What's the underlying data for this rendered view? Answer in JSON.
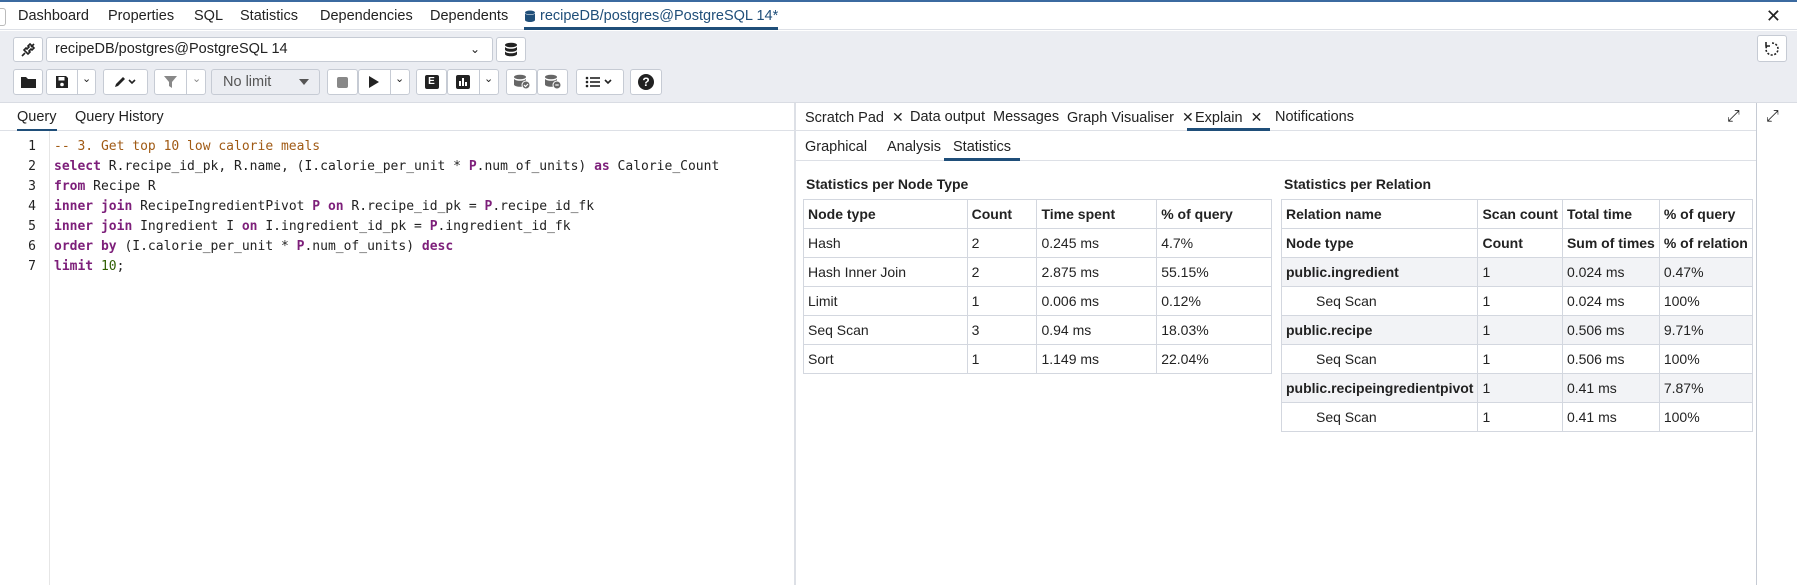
{
  "top_tabs": [
    "Dashboard",
    "Properties",
    "SQL",
    "Statistics",
    "Dependencies",
    "Dependents"
  ],
  "active_tab": "recipeDB/postgres@PostgreSQL 14*",
  "connection": "recipeDB/postgres@PostgreSQL 14",
  "limit": "No limit",
  "left_tabs": [
    "Query",
    "Query History"
  ],
  "code_lines": [
    "-- 3. Get top 10 low calorie meals",
    "select R.recipe_id_pk, R.name, (I.calorie_per_unit * P.num_of_units) as Calorie_Count",
    "from Recipe R",
    "inner join RecipeIngredientPivot P on R.recipe_id_pk = P.recipe_id_fk",
    "inner join Ingredient I on I.ingredient_id_pk = P.ingredient_id_fk",
    "order by (I.calorie_per_unit * P.num_of_units) desc",
    "limit 10;"
  ],
  "right_tabs": [
    "Scratch Pad",
    "Data output",
    "Messages",
    "Graph Visualiser",
    "Explain",
    "Notifications"
  ],
  "sub_tabs": [
    "Graphical",
    "Analysis",
    "Statistics"
  ],
  "node_stats": {
    "title": "Statistics per Node Type",
    "headers": [
      "Node type",
      "Count",
      "Time spent",
      "% of query"
    ],
    "rows": [
      [
        "Hash",
        "2",
        "0.245 ms",
        "4.7%"
      ],
      [
        "Hash Inner Join",
        "2",
        "2.875 ms",
        "55.15%"
      ],
      [
        "Limit",
        "1",
        "0.006 ms",
        "0.12%"
      ],
      [
        "Seq Scan",
        "3",
        "0.94 ms",
        "18.03%"
      ],
      [
        "Sort",
        "1",
        "1.149 ms",
        "22.04%"
      ]
    ]
  },
  "relation_stats": {
    "title": "Statistics per Relation",
    "headers": [
      "Relation name",
      "Scan count",
      "Total time",
      "% of query"
    ],
    "subheaders": [
      "Node type",
      "Count",
      "Sum of times",
      "% of relation"
    ],
    "relations": [
      {
        "row": [
          "public.ingredient",
          "1",
          "0.024 ms",
          "0.47%"
        ],
        "child": [
          "Seq Scan",
          "1",
          "0.024 ms",
          "100%"
        ]
      },
      {
        "row": [
          "public.recipe",
          "1",
          "0.506 ms",
          "9.71%"
        ],
        "child": [
          "Seq Scan",
          "1",
          "0.506 ms",
          "100%"
        ]
      },
      {
        "row": [
          "public.recipeingredientpivot",
          "1",
          "0.41 ms",
          "7.87%"
        ],
        "child": [
          "Seq Scan",
          "1",
          "0.41 ms",
          "100%"
        ]
      }
    ]
  },
  "icons": {
    "database": "database-icon",
    "close": "close-icon",
    "refresh": "refresh-icon",
    "folder": "folder-icon",
    "save": "save-icon",
    "edit": "edit-pen-icon",
    "filter": "filter-icon",
    "stop": "stop-icon",
    "play": "play-icon",
    "explain": "explain-icon",
    "explain-analyze": "explain-analyze-icon",
    "commit": "commit-icon",
    "rollback": "rollback-icon",
    "macros": "macros-icon",
    "help": "help-icon",
    "expand": "expand-icon"
  },
  "colors": {
    "accent": "#1f4e79",
    "keyword": "#7d1f7a",
    "comment": "#a05a14"
  }
}
